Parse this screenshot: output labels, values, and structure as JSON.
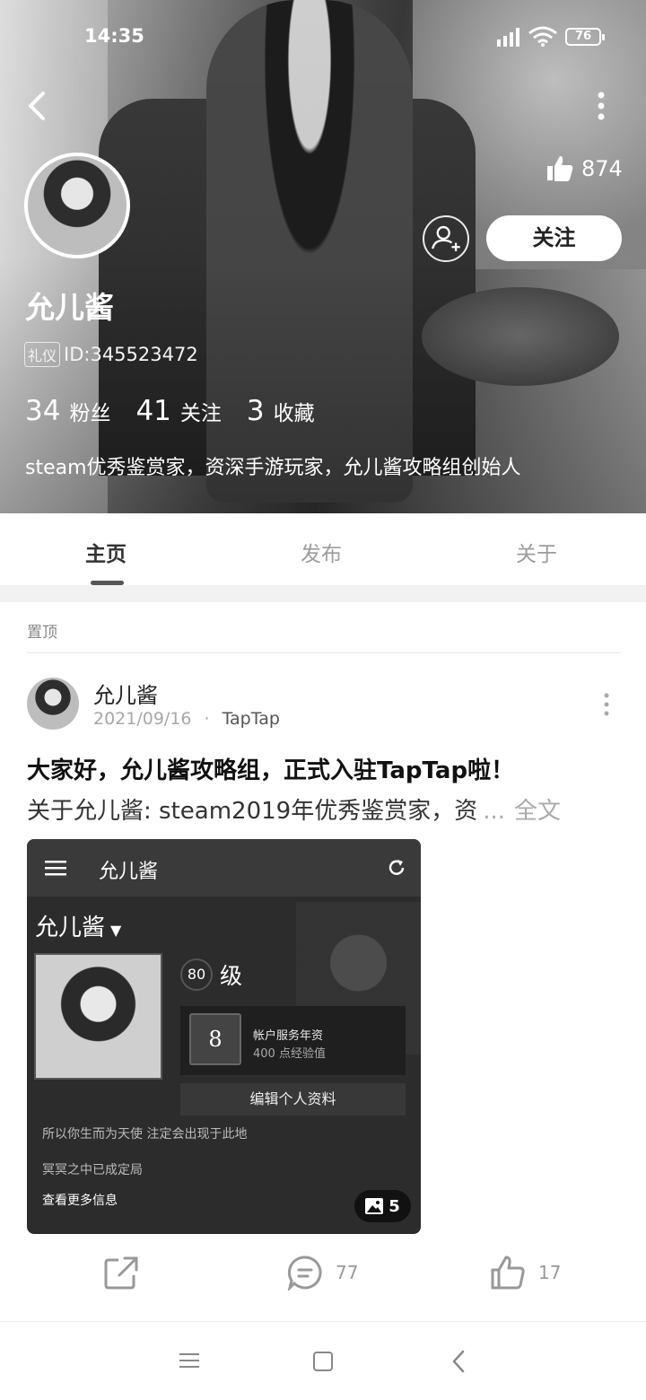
{
  "status_bar": {
    "time": "14:35",
    "battery": "76"
  },
  "profile": {
    "likes": "874",
    "follow_label": "关注",
    "name": "允儿酱",
    "tag": "礼仪",
    "id": "ID:345523472",
    "stats": [
      {
        "value": "34",
        "label": "粉丝"
      },
      {
        "value": "41",
        "label": "关注"
      },
      {
        "value": "3",
        "label": "收藏"
      }
    ],
    "bio": "steam优秀鉴赏家，资深手游玩家，允儿酱攻略组创始人"
  },
  "tabs": [
    {
      "label": "主页",
      "active": true
    },
    {
      "label": "发布",
      "active": false
    },
    {
      "label": "关于",
      "active": false
    }
  ],
  "pinned_label": "置顶",
  "post": {
    "author": "允儿酱",
    "date": "2021/09/16",
    "separator": "·",
    "source": "TapTap",
    "title": "大家好，允儿酱攻略组，正式入驻TapTap啦！",
    "body": "关于允儿酱: steam2019年优秀鉴赏家，资",
    "ellipsis": "...",
    "full_text": "全文",
    "image_card": {
      "bar_title": "允儿酱",
      "username": "允儿酱",
      "level": "80",
      "level_label": "级",
      "badge_glyph": "8",
      "badge_title": "帐户服务年资",
      "badge_sub": "400 点经验值",
      "edit_button": "编辑个人资料",
      "line1": "所以你生而为天使 注定会出现于此地",
      "line2": "冥冥之中已成定局",
      "more_info": "查看更多信息",
      "image_count": "5"
    },
    "comment_count": "77",
    "like_count": "17"
  },
  "colors": {
    "accent": "#222222",
    "muted": "#9a9a9a",
    "background": "#ffffff",
    "band": "#f2f2f2"
  }
}
